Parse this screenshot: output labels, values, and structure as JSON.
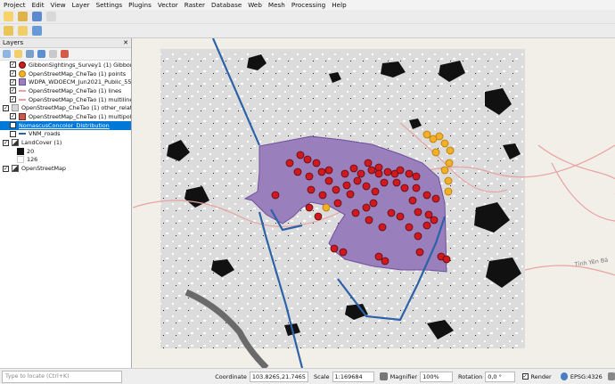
{
  "menu": [
    "Project",
    "Edit",
    "View",
    "Layer",
    "Settings",
    "Plugins",
    "Vector",
    "Raster",
    "Database",
    "Web",
    "Mesh",
    "Processing",
    "Help"
  ],
  "layers_panel": {
    "title": "Layers",
    "layers": [
      {
        "label": "GibbonSightings_Survey1 (1) Gibbon",
        "checked": true,
        "symbol": "red-dot",
        "selected": false,
        "indent": 1
      },
      {
        "label": "OpenStreetMap_CheTao (1) points",
        "checked": true,
        "symbol": "yellow-dot",
        "selected": false,
        "indent": 1
      },
      {
        "label": "WDPA_WDOECM_Jun2021_Public_55",
        "checked": true,
        "symbol": "purple-fill",
        "selected": false,
        "indent": 1
      },
      {
        "label": "OpenStreetMap_CheTao (1) lines",
        "checked": true,
        "symbol": "pink-line",
        "selected": false,
        "indent": 1
      },
      {
        "label": "OpenStreetMap_CheTao (1) multiline",
        "checked": true,
        "symbol": "pink-line",
        "selected": false,
        "indent": 1
      },
      {
        "label": "OpenStreetMap_CheTao (1) other_relatio",
        "checked": true,
        "symbol": "grey-box",
        "selected": false,
        "indent": 0
      },
      {
        "label": "OpenStreetMap_CheTao (1) multipol",
        "checked": true,
        "symbol": "brown-fill",
        "selected": false,
        "indent": 1
      },
      {
        "label": "NomascusConcolor_Distribution",
        "checked": true,
        "symbol": "none",
        "selected": true,
        "indent": 1
      },
      {
        "label": "VNM_roads",
        "checked": false,
        "symbol": "blue-line",
        "selected": false,
        "indent": 1
      },
      {
        "label": "LandCover (1)",
        "checked": true,
        "symbol": "raster",
        "selected": false,
        "indent": 0
      },
      {
        "label": "20",
        "checked": null,
        "symbol": "black-swatch",
        "selected": false,
        "indent": 2
      },
      {
        "label": "126",
        "checked": null,
        "symbol": "white-swatch",
        "selected": false,
        "indent": 2
      },
      {
        "label": "OpenStreetMap",
        "checked": true,
        "symbol": "raster",
        "selected": false,
        "indent": 0
      }
    ]
  },
  "map": {
    "road_label": "Tỉnh Yên Bá",
    "colors": {
      "protected_area": "#9a7fbd",
      "sighting": "#d0191e",
      "osm_point": "#f2b024",
      "distribution": "#2b62a8"
    }
  },
  "statusbar": {
    "locate_placeholder": "Type to locate (Ctrl+K)",
    "coordinate_label": "Coordinate",
    "coordinate_value": "103.8265,21.7465",
    "scale_label": "Scale",
    "scale_value": "1:169684",
    "magnifier_label": "Magnifier",
    "magnifier_value": "100%",
    "rotation_label": "Rotation",
    "rotation_value": "0,0 °",
    "render_label": "Render",
    "crs_label": "EPSG:4326"
  }
}
